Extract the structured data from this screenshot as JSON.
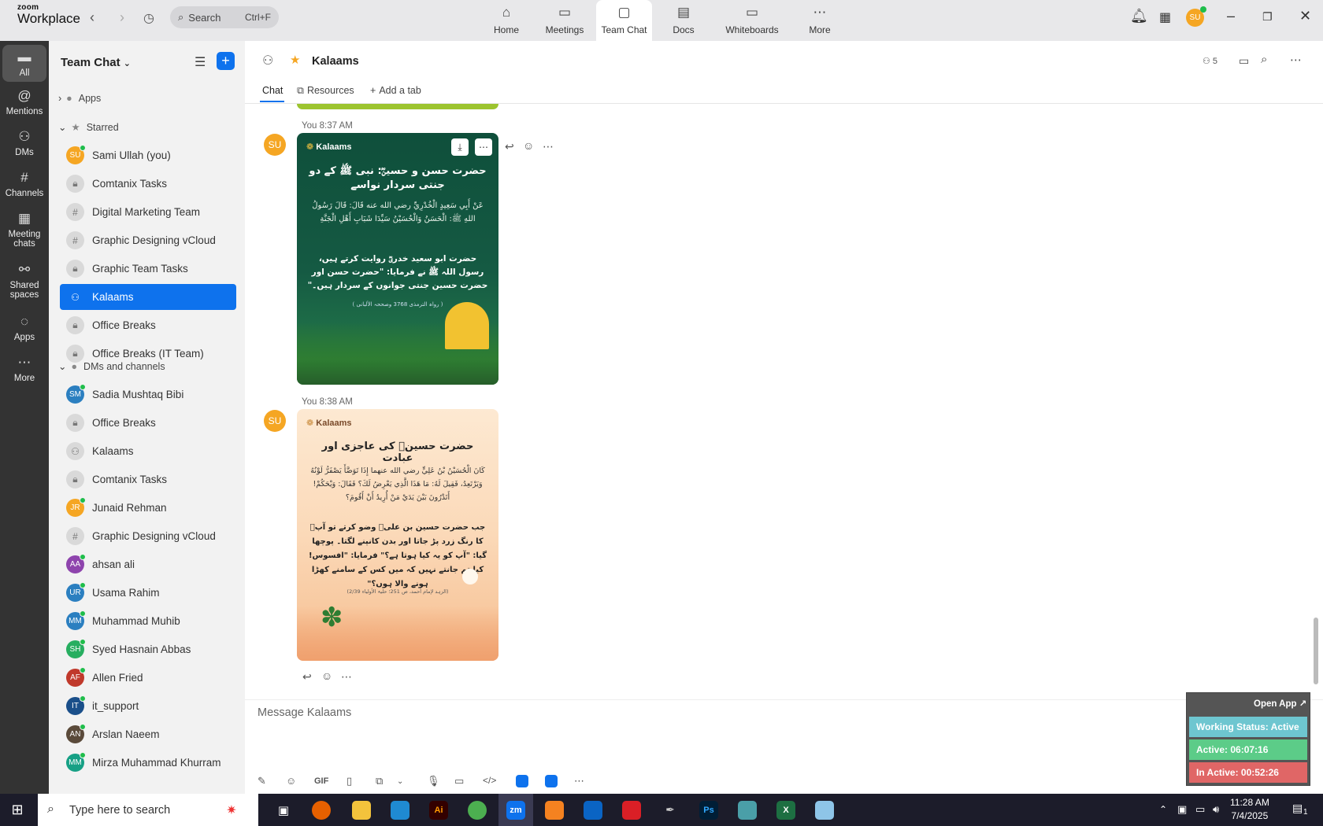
{
  "app": {
    "logo_line1": "zoom",
    "logo_line2": "Workplace"
  },
  "search": {
    "label": "Search",
    "shortcut": "Ctrl+F"
  },
  "tabs": [
    {
      "label": "Home",
      "icon": "home-icon"
    },
    {
      "label": "Meetings",
      "icon": "video-icon"
    },
    {
      "label": "Team Chat",
      "icon": "chat-icon"
    },
    {
      "label": "Docs",
      "icon": "doc-icon"
    },
    {
      "label": "Whiteboards",
      "icon": "whiteboard-icon"
    },
    {
      "label": "More",
      "icon": "more-icon"
    }
  ],
  "user_badge": "SU",
  "rail": [
    {
      "label": "All",
      "icon": "chat-icon"
    },
    {
      "label": "Mentions",
      "icon": "at-icon"
    },
    {
      "label": "DMs",
      "icon": "people-icon"
    },
    {
      "label": "Channels",
      "icon": "hash-icon"
    },
    {
      "label": "Meeting chats",
      "icon": "calendar-icon"
    },
    {
      "label": "Shared spaces",
      "icon": "share-icon"
    },
    {
      "label": "Apps",
      "icon": "apps-icon"
    },
    {
      "label": "More",
      "icon": "more-icon"
    }
  ],
  "sidebar": {
    "title": "Team Chat",
    "apps_label": "Apps",
    "starred_label": "Starred",
    "dms_label": "DMs and channels",
    "starred": [
      {
        "label": "Sami Ullah (you)",
        "avatar": "SU",
        "color": "#f5a623",
        "type": "user"
      },
      {
        "label": "Comtanix Tasks",
        "type": "lock"
      },
      {
        "label": "Digital Marketing Team",
        "type": "hash"
      },
      {
        "label": "Graphic Designing vCloud",
        "type": "hash"
      },
      {
        "label": "Graphic Team Tasks",
        "type": "lock"
      },
      {
        "label": "Kalaams",
        "type": "group"
      },
      {
        "label": "Office Breaks",
        "type": "lock"
      },
      {
        "label": "Office Breaks (IT Team)",
        "type": "lock"
      }
    ],
    "dms": [
      {
        "label": "Sadia Mushtaq Bibi",
        "avatar": "SM",
        "color": "#2b7fc0",
        "type": "user"
      },
      {
        "label": "Office Breaks",
        "type": "lock"
      },
      {
        "label": "Kalaams",
        "type": "group"
      },
      {
        "label": "Comtanix Tasks",
        "type": "lock"
      },
      {
        "label": "Junaid Rehman",
        "avatar": "JR",
        "color": "#f5a623",
        "type": "user"
      },
      {
        "label": "Graphic Designing vCloud",
        "type": "hash"
      },
      {
        "label": "ahsan ali",
        "avatar": "AA",
        "color": "#8e44ad",
        "type": "user"
      },
      {
        "label": "Usama Rahim",
        "avatar": "UR",
        "color": "#2b7fc0",
        "type": "user"
      },
      {
        "label": "Muhammad Muhib",
        "avatar": "MM",
        "color": "#2b7fc0",
        "type": "user"
      },
      {
        "label": "Syed Hasnain Abbas",
        "avatar": "SH",
        "color": "#27ae60",
        "type": "user"
      },
      {
        "label": "Allen Fried",
        "avatar": "AF",
        "color": "#c0392b",
        "type": "user"
      },
      {
        "label": "it_support",
        "avatar": "IT",
        "color": "#1a4f8a",
        "type": "user"
      },
      {
        "label": "Arslan Naeem",
        "avatar": "AN",
        "color": "#5a4a3a",
        "type": "user"
      },
      {
        "label": "Mirza Muhammad Khurram",
        "avatar": "MM",
        "color": "#16a085",
        "type": "user"
      }
    ]
  },
  "chat": {
    "title": "Kalaams",
    "members": "5",
    "subtabs": [
      "Chat",
      "Resources",
      "Add a tab"
    ],
    "messages": [
      {
        "sender": "You",
        "time": "8:37 AM",
        "avatar": "SU",
        "brand": "Kalaams",
        "title": "حضرت حسن و حسینؓ: نبی ﷺ کے دو جنتی سردار نواسے",
        "arabic": "عَنْ أَبِي سَعِيدٍ الْخُدْرِيِّ رضي الله عنه قَالَ: قَالَ رَسُولُ اللهِ ﷺ: الْحَسَنُ وَالْحُسَيْنُ سَيِّدَا شَبَابِ أَهْلِ الْجَنَّةِ",
        "urdu": "حضرت ابو سعید خدریؓ روایت کرتے ہیں، رسول اللہ ﷺ نے فرمایا: \"حضرت حسن اور حضرت حسین جنتی جوانوں کے سردار ہیں۔\"",
        "ref": "( رواہ الترمذی 3768 وصححہ الألبانی )"
      },
      {
        "sender": "You",
        "time": "8:38 AM",
        "avatar": "SU",
        "brand": "Kalaams",
        "title": "حضرت حسینؓ کی عاجزی اور عبادت",
        "arabic": "كَانَ الْحُسَيْنُ بْنُ عَلِيٍّ رضي الله عنهما إِذَا تَوَضَّأَ يَصْفَرُّ لَوْنُهُ وَيَرْتَعِدُ، فَقِيلَ لَهُ: مَا هَذَا الَّذِي يَعْرِضُ لَكَ؟ فَقَالَ: وَيْحَكُمْ! أَتَدْرُونَ بَيْنَ يَدَيْ مَنْ أُرِيدُ أَنْ أَقُومَ؟",
        "urdu": "جب حضرت حسین بن علیؓ وضو کرتے تو آپؓ کا رنگ زرد پڑ جاتا اور بدن کانپنے لگتا۔ پوچھا گیا: \"آپ کو یہ کیا ہوتا ہے؟\" فرمایا: \"افسوس! کیا تم جانتے نہیں کہ میں کس کے سامنے کھڑا ہونے والا ہوں؟\"",
        "ref": "(الزہد لإمام أحمد، ص 251؛ حلیۃ الأولیاء 2/39)"
      }
    ],
    "composer_placeholder": "Message Kalaams",
    "gif_label": "GIF"
  },
  "widget": {
    "open_app": "Open App ↗",
    "working_status": "Working Status: Active",
    "active": "Active: 06:07:16",
    "inactive": "In Active: 00:52:26",
    "colors": {
      "status": "#6ec6d0",
      "active": "#5ccc88",
      "inactive": "#e06666"
    }
  },
  "taskbar": {
    "search_placeholder": "Type here to search",
    "time": "11:28 AM",
    "date": "7/4/2025",
    "notif_count": "1"
  },
  "colors": {
    "accent": "#0e72ed",
    "rail": "#333333"
  }
}
